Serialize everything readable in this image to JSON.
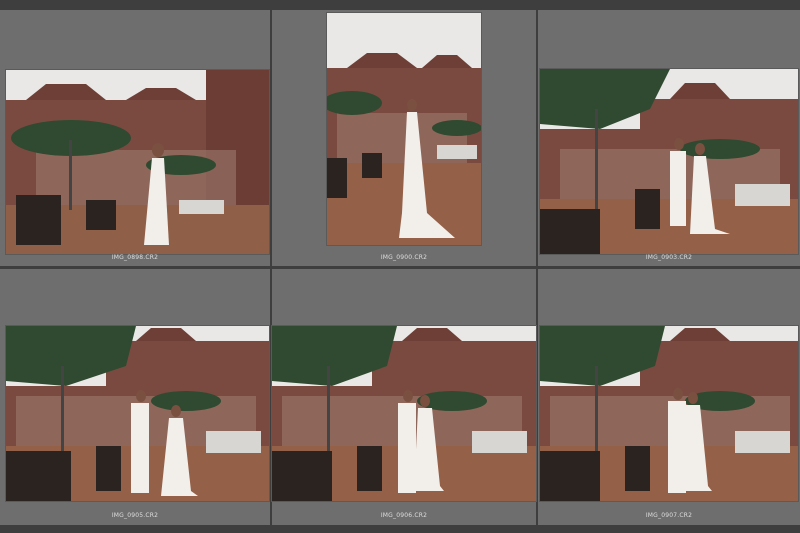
{
  "grid": {
    "thumbnails": [
      {
        "filename": "IMG_0898.CR2",
        "subject": "bride-standing-left"
      },
      {
        "filename": "IMG_0900.CR2",
        "subject": "bride-portrait"
      },
      {
        "filename": "IMG_0903.CR2",
        "subject": "couple-right"
      },
      {
        "filename": "IMG_0905.CR2",
        "subject": "couple-center"
      },
      {
        "filename": "IMG_0906.CR2",
        "subject": "couple-center"
      },
      {
        "filename": "IMG_0907.CR2",
        "subject": "couple-center"
      }
    ]
  },
  "colors": {
    "cell_bg": "#6e6e6e",
    "gutter": "#3e3e3e",
    "label": "#dedede"
  }
}
